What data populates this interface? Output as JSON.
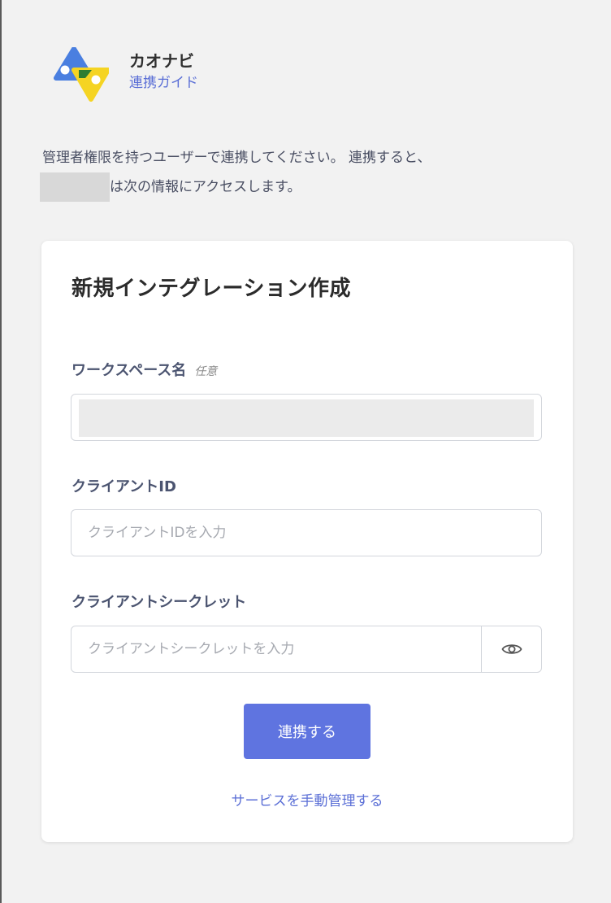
{
  "header": {
    "app_name": "カオナビ",
    "guide_link": "連携ガイド"
  },
  "intro": {
    "line1": "管理者権限を持つユーザーで連携してください。 連携すると、",
    "line2": "は次の情報にアクセスします。"
  },
  "form": {
    "title": "新規インテグレーション作成",
    "workspace": {
      "label": "ワークスペース名",
      "optional_tag": "任意"
    },
    "client_id": {
      "label": "クライアントID",
      "placeholder": "クライアントIDを入力",
      "value": ""
    },
    "client_secret": {
      "label": "クライアントシークレット",
      "placeholder": "クライアントシークレットを入力",
      "value": ""
    },
    "submit_label": "連携する",
    "manual_link": "サービスを手動管理する"
  },
  "colors": {
    "accent": "#5f74e0",
    "link": "#5b6fd6",
    "logo_blue": "#4a7fe0",
    "logo_yellow": "#f5d423",
    "logo_green": "#2f7d32"
  },
  "icons": {
    "logo": "kaonavi-logo-icon",
    "password_toggle": "eye-icon"
  }
}
